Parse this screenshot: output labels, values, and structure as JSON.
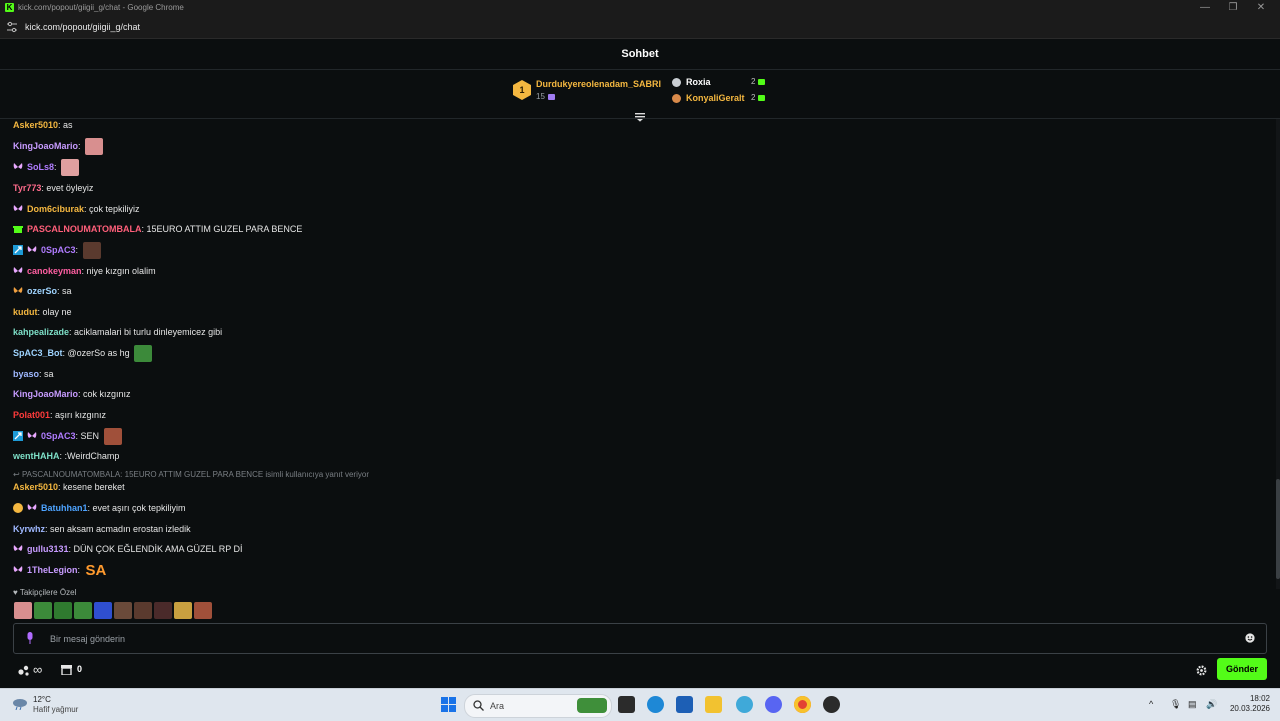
{
  "window": {
    "title": "kick.com/popout/giigii_g/chat - Google Chrome",
    "url": "kick.com/popout/giigii_g/chat",
    "brand_color": "#53fc18"
  },
  "chat": {
    "title": "Sohbet",
    "leaderboard": {
      "first": {
        "rank": "1",
        "name": "Durdukyereolenadam_SABRI",
        "count": "15"
      },
      "others": [
        {
          "name": "Roxia",
          "count": "2"
        },
        {
          "name": "KonyaliGeralt",
          "count": "2"
        }
      ]
    },
    "messages": [
      {
        "user": "Asker5010",
        "text": ": as",
        "color": "#f4b740"
      },
      {
        "user": "KingJoaoMario",
        "text": ":",
        "color": "#c79bff"
      },
      {
        "user": "SoLs8",
        "text": ":",
        "color": "#b07cff"
      },
      {
        "user": "Tyr773",
        "text": ": evet öyleyiz",
        "color": "#ff6b8b"
      },
      {
        "user": "Dom6ciburak",
        "text": ": çok tepkiliyiz",
        "color": "#f4b740"
      },
      {
        "user": "PASCALNOUMATOMBALA",
        "text": ": 15EURO ATTIM GUZEL PARA BENCE",
        "color": "#ff5f7a"
      },
      {
        "user": "0SpAC3",
        "text": ":",
        "color": "#b07cff"
      },
      {
        "user": "canokeyman",
        "text": ": niye kızgın olalim",
        "color": "#ff5fa2"
      },
      {
        "user": "ozerSo",
        "text": ": sa",
        "color": "#9fd4ff"
      },
      {
        "user": "kudut",
        "text": ": olay ne",
        "color": "#f4b740"
      },
      {
        "user": "kahpealizade",
        "text": ": aciklamalari bi turlu dinleyemicez gibi",
        "color": "#7ee0c8"
      },
      {
        "user": "SpAC3_Bot",
        "text": ": @ozerSo as hg",
        "color": "#9fd4ff"
      },
      {
        "user": "byaso",
        "text": ": sa",
        "color": "#9fb8ff"
      },
      {
        "user": "KingJoaoMario",
        "text": ": cok kızgınız",
        "color": "#c79bff"
      },
      {
        "user": "Polat001",
        "text": ": aşırı kızgınız",
        "color": "#ff3b3b"
      },
      {
        "user": "0SpAC3",
        "text": ": SEN",
        "color": "#b07cff"
      },
      {
        "user": "wentHAHA",
        "text": ": :WeirdChamp",
        "color": "#7ee0c8"
      },
      {
        "user": "Asker5010",
        "text": ": kesene bereket",
        "color": "#f4b740"
      },
      {
        "user": "Batuhhan1",
        "text": ": evet aşırı çok tepkiliyim",
        "color": "#4da3ff"
      },
      {
        "user": "Kyrwhz",
        "text": ": sen aksam acmadın erostan izledik",
        "color": "#9fb8ff"
      },
      {
        "user": "gullu3131",
        "text": ": DÜN ÇOK EĞLENDİK AMA GÜZEL RP Dİ",
        "color": "#c79bff"
      },
      {
        "user": "1TheLegion",
        "text": ":",
        "color": "#c79bff"
      }
    ],
    "reply_context": "PASCALNOUMATOMBALA: 15EURO ATTIM GUZEL PARA BENCE isimli kullanıcıya yanıt veriyor",
    "emote_sa_text": "SA",
    "follower_only_label": "Takipçilere Özel",
    "input": {
      "placeholder": "Bir mesaj gönderin",
      "value": ""
    },
    "points_symbol": "∞",
    "store_count": "0",
    "send_label": "Gönder"
  },
  "taskbar": {
    "temperature": "12°C",
    "condition": "Hafif yağmur",
    "search_placeholder": "Ara",
    "time": "18:02",
    "date": "20.03.2026"
  }
}
